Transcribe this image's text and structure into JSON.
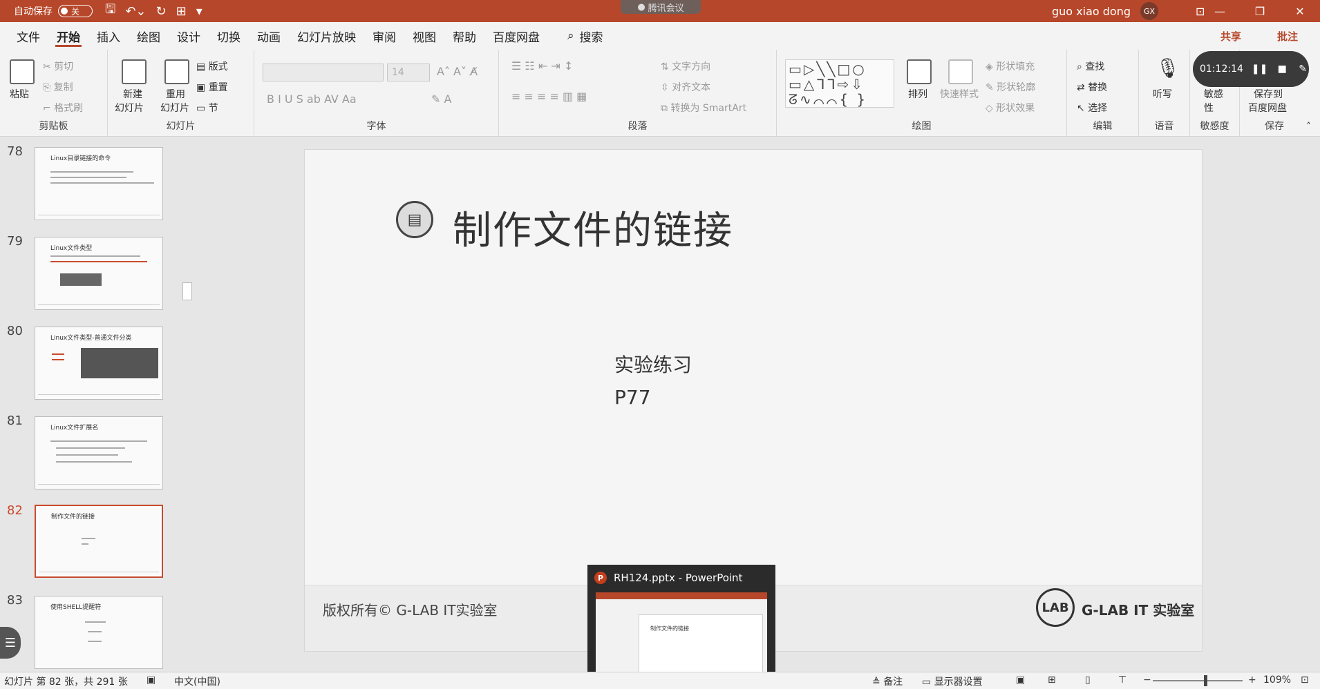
{
  "titlebar": {
    "autosave_label": "自动保存",
    "autosave_state": "关",
    "meeting_badge": "腾讯会议",
    "user_name": "guo xiao dong",
    "user_initials": "GX"
  },
  "tabs": [
    "文件",
    "开始",
    "插入",
    "绘图",
    "设计",
    "切换",
    "动画",
    "幻灯片放映",
    "审阅",
    "视图",
    "帮助",
    "百度网盘"
  ],
  "active_tab": "开始",
  "search_label": "搜索",
  "share_label": "共享",
  "comment_label": "批注",
  "ribbon": {
    "clipboard": {
      "label": "剪贴板",
      "paste": "粘贴",
      "cut": "剪切",
      "copy": "复制",
      "format_painter": "格式刷"
    },
    "slides": {
      "label": "幻灯片",
      "new_slide_1": "新建",
      "new_slide_2": "幻灯片",
      "reuse_1": "重用",
      "reuse_2": "幻灯片",
      "layout": "版式",
      "reset": "重置",
      "section": "节"
    },
    "font": {
      "label": "字体",
      "size": "14"
    },
    "paragraph": {
      "label": "段落",
      "text_direction": "文字方向",
      "align_text": "对齐文本",
      "smartart": "转换为 SmartArt"
    },
    "drawing": {
      "label": "绘图",
      "arrange": "排列",
      "quick_styles": "快速样式",
      "shape_fill": "形状填充",
      "shape_outline": "形状轮廓",
      "shape_effects": "形状效果"
    },
    "editing": {
      "label": "编辑",
      "find": "查找",
      "replace": "替换",
      "select": "选择"
    },
    "voice": {
      "label": "语音",
      "dictate": "听写"
    },
    "sensitivity": {
      "label": "敏感度",
      "btn_1": "敏感",
      "btn_2": "性"
    },
    "save": {
      "label": "保存",
      "btn_1": "保存到",
      "btn_2": "百度网盘"
    }
  },
  "meeting_widget": {
    "time": "01:12:14"
  },
  "thumbnails": [
    {
      "num": "78",
      "title": "Linux目录链接的命令"
    },
    {
      "num": "79",
      "title": "Linux文件类型"
    },
    {
      "num": "80",
      "title": "Linux文件类型-普通文件分类"
    },
    {
      "num": "81",
      "title": "Linux文件扩展名"
    },
    {
      "num": "82",
      "title": "制作文件的链接"
    },
    {
      "num": "83",
      "title": "使用SHELL提醒符"
    }
  ],
  "selected_slide": "82",
  "slide": {
    "title": "制作文件的链接",
    "body_line1": "实验练习",
    "body_line2": "P77",
    "copyright": "版权所有© G-LAB IT实验室",
    "logo_mark": "LAB",
    "logo_text": "G-LAB IT 实验室"
  },
  "task_preview": {
    "title": "RH124.pptx - PowerPoint",
    "mini_title": "制作文件的链接"
  },
  "statusbar": {
    "slide_info": "幻灯片 第 82 张，共 291 张",
    "language": "中文(中国)",
    "notes": "备注",
    "display_settings": "显示器设置",
    "zoom": "109%"
  }
}
